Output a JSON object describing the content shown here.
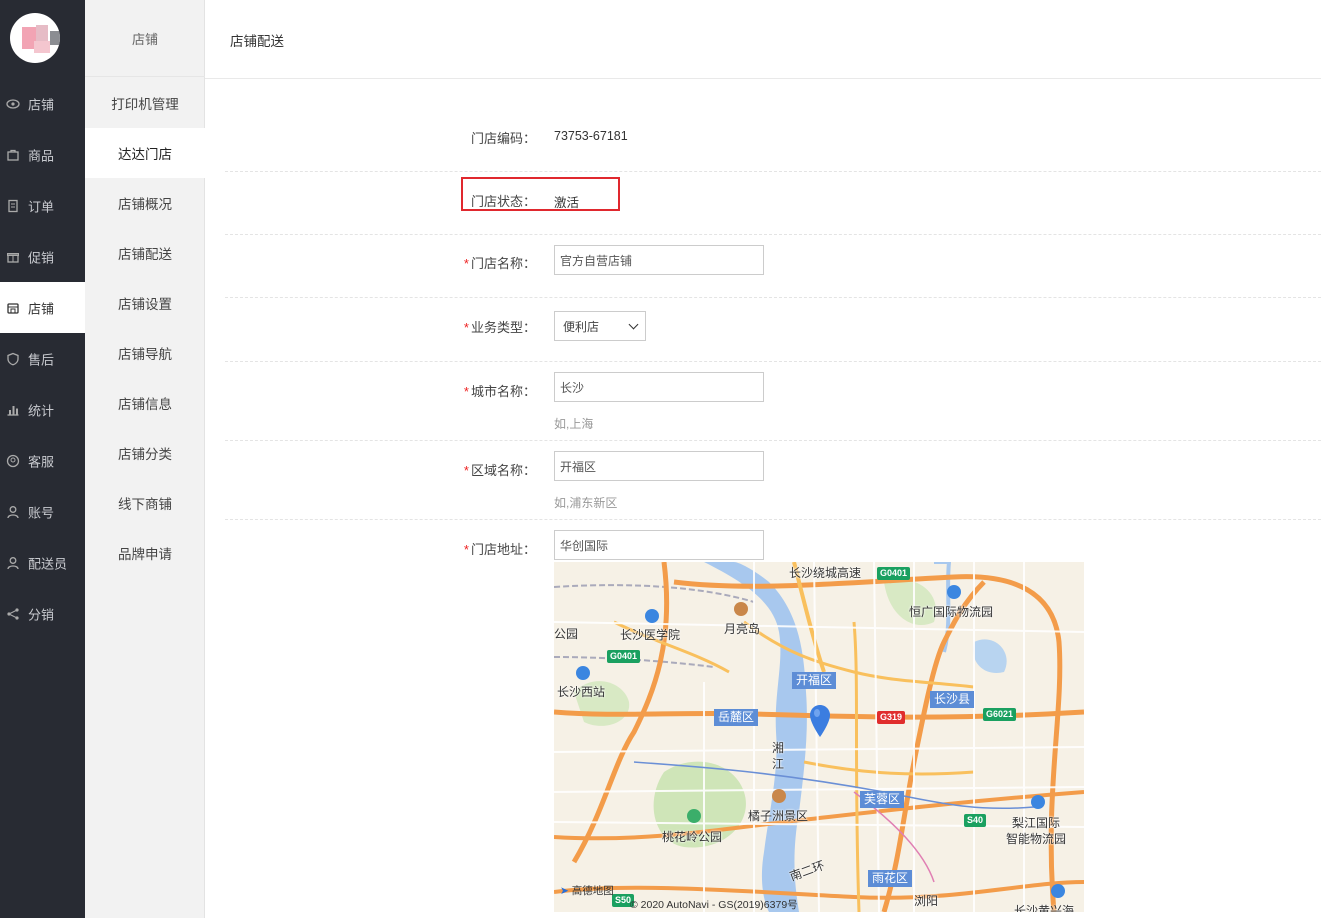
{
  "rail": {
    "items": [
      {
        "label": "店铺",
        "icon": "eye-icon"
      },
      {
        "label": "商品",
        "icon": "bag-icon"
      },
      {
        "label": "订单",
        "icon": "document-icon"
      },
      {
        "label": "促销",
        "icon": "gift-icon"
      },
      {
        "label": "店铺",
        "icon": "store-icon"
      },
      {
        "label": "售后",
        "icon": "shield-icon"
      },
      {
        "label": "统计",
        "icon": "bar-chart-icon"
      },
      {
        "label": "客服",
        "icon": "headset-icon"
      },
      {
        "label": "账号",
        "icon": "user-icon"
      },
      {
        "label": "配送员",
        "icon": "courier-icon"
      },
      {
        "label": "分销",
        "icon": "share-icon"
      }
    ],
    "active_index": 4
  },
  "subnav": {
    "title": "店铺",
    "items": [
      "打印机管理",
      "达达门店",
      "店铺概况",
      "店铺配送",
      "店铺设置",
      "店铺导航",
      "店铺信息",
      "店铺分类",
      "线下商铺",
      "品牌申请"
    ],
    "active_index": 1
  },
  "header": {
    "title": "店铺配送"
  },
  "form": {
    "store_code_label": "门店编码：",
    "store_code_value": "73753-67181",
    "store_status_label": "门店状态：",
    "store_status_value": "激活",
    "store_name_label": "门店名称：",
    "store_name_value": "官方自营店铺",
    "biz_type_label": "业务类型：",
    "biz_type_value": "便利店",
    "city_label": "城市名称：",
    "city_value": "长沙",
    "city_hint": "如,上海",
    "district_label": "区域名称：",
    "district_value": "开福区",
    "district_hint": "如,浦东新区",
    "address_label": "门店地址：",
    "address_value": "华创国际",
    "required_mark": "*"
  },
  "map": {
    "labels": {
      "med": "长沙医学院",
      "moon": "月亮岛",
      "logistics": "恒广国际物流园",
      "west_station": "长沙西站",
      "park_partial": "公园",
      "ring": "长沙绕城高速",
      "xiang": "湘",
      "jiang": "江",
      "orange": "橘子洲景区",
      "peach": "桃花岭公园",
      "lijiang1": "梨江国际",
      "lijiang2": "智能物流园",
      "second_ring": "南二环",
      "bottom_right": "长沙黄兴海",
      "bottom_mid": "浏阳",
      "brand": "高德地图",
      "copyright": "© 2020 AutoNavi - GS(2019)6379号"
    },
    "districts": {
      "kaifu": "开福区",
      "yuelu": "岳麓区",
      "changsha_county": "长沙县",
      "furong": "芙蓉区",
      "yuhua": "雨花区"
    },
    "shields": {
      "g0401_top": "G0401",
      "g0401_left": "G0401",
      "g319": "G319",
      "g6021": "G6021",
      "s40": "S40",
      "s50": "S50"
    },
    "colors": {
      "marker": "#3b7de0",
      "district_tag": "#5d8dd6",
      "highway": "#f39c4a",
      "river": "#a8c8ee"
    }
  }
}
